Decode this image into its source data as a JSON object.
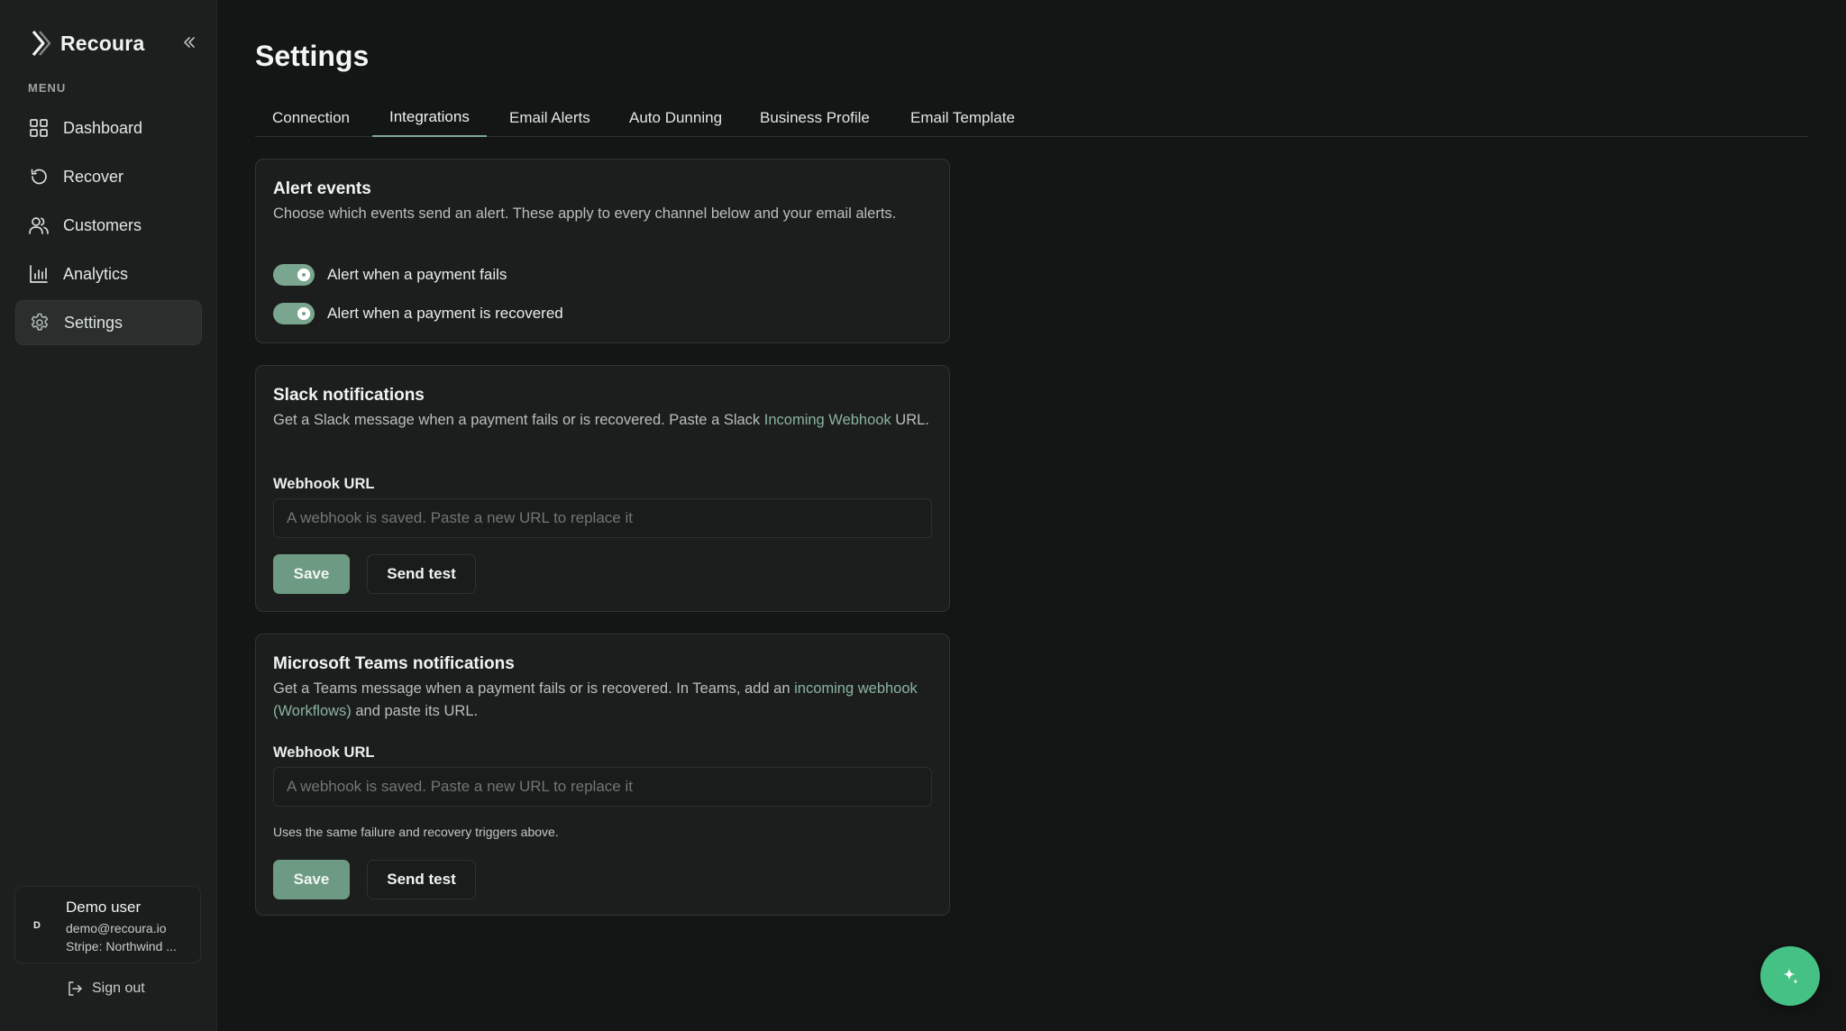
{
  "app": {
    "name": "Recoura"
  },
  "sidebar": {
    "menu_label": "MENU",
    "items": [
      {
        "label": "Dashboard",
        "icon": "grid-icon"
      },
      {
        "label": "Recover",
        "icon": "refresh-icon"
      },
      {
        "label": "Customers",
        "icon": "users-icon"
      },
      {
        "label": "Analytics",
        "icon": "bar-chart-icon"
      },
      {
        "label": "Settings",
        "icon": "gear-icon",
        "active": true
      }
    ],
    "user": {
      "initial": "D",
      "name": "Demo user",
      "email": "demo@recoura.io",
      "stripe": "Stripe: Northwind ..."
    },
    "sign_out": "Sign out"
  },
  "page": {
    "title": "Settings"
  },
  "tabs": [
    {
      "label": "Connection"
    },
    {
      "label": "Integrations",
      "active": true
    },
    {
      "label": "Email Alerts"
    },
    {
      "label": "Auto Dunning"
    },
    {
      "label": "Business Profile"
    },
    {
      "label": "Email Template"
    }
  ],
  "alert_events": {
    "title": "Alert events",
    "description": "Choose which events send an alert. These apply to every channel below and your email alerts.",
    "toggles": [
      {
        "label": "Alert when a payment fails",
        "on": true
      },
      {
        "label": "Alert when a payment is recovered",
        "on": true
      }
    ]
  },
  "slack": {
    "title": "Slack notifications",
    "desc_before": "Get a Slack message when a payment fails or is recovered. Paste a Slack ",
    "desc_link": "Incoming Webhook",
    "desc_after": " URL.",
    "field_label": "Webhook URL",
    "placeholder": "A webhook is saved. Paste a new URL to replace it",
    "save_label": "Save",
    "test_label": "Send test"
  },
  "teams": {
    "title": "Microsoft Teams notifications",
    "desc_before": "Get a Teams message when a payment fails or is recovered. In Teams, add an ",
    "desc_link": "incoming webhook (Workflows)",
    "desc_after": " and paste its URL.",
    "field_label": "Webhook URL",
    "placeholder": "A webhook is saved. Paste a new URL to replace it",
    "helper": "Uses the same failure and recovery triggers above.",
    "save_label": "Save",
    "test_label": "Send test"
  },
  "colors": {
    "accent": "#7aa68f",
    "link": "#89b49e",
    "fab": "#45c185",
    "background": "#141515",
    "sidebar": "#1d1f1f"
  },
  "fab": {
    "icon": "sparkle-icon"
  }
}
